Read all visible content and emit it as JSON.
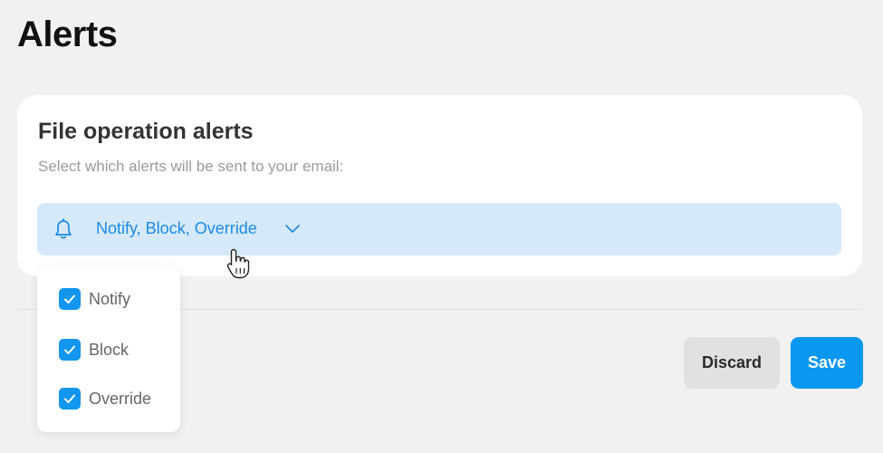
{
  "page": {
    "title": "Alerts"
  },
  "card": {
    "title": "File operation alerts",
    "subtitle": "Select which alerts will be sent to your email:",
    "select": {
      "icon": "bell-icon",
      "value": "Notify, Block, Override",
      "chevron": "chevron-down-icon"
    }
  },
  "dropdown": {
    "options": [
      {
        "label": "Notify",
        "checked": true
      },
      {
        "label": "Block",
        "checked": true
      },
      {
        "label": "Override",
        "checked": true
      }
    ]
  },
  "actions": {
    "discard_label": "Discard",
    "save_label": "Save"
  },
  "colors": {
    "accent": "#0a97f0",
    "select_bg": "#d6e9fa",
    "select_text": "#1a8be6",
    "background": "#f1f1f1"
  },
  "cursor": {
    "icon": "hand-pointer-icon"
  }
}
